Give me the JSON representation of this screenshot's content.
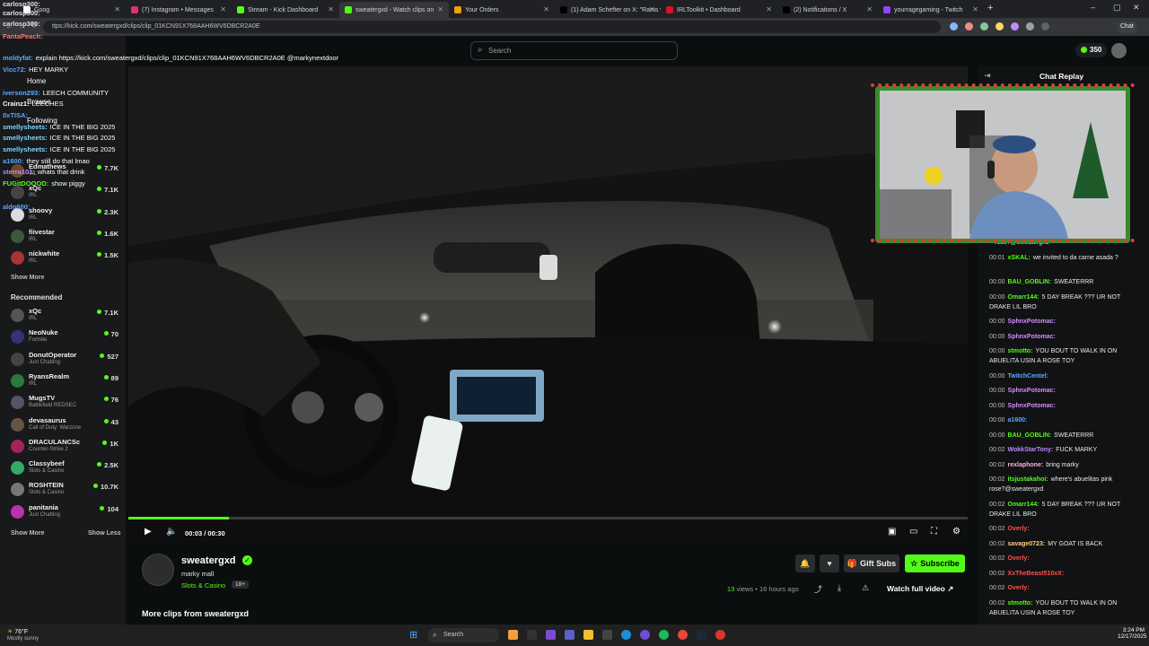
{
  "browser": {
    "tabs": [
      {
        "label": "Goog",
        "color": "#ffffff"
      },
      {
        "label": "(7) Instagram • Messages",
        "color": "#e1306c"
      },
      {
        "label": "Stream - Kick Dashboard",
        "color": "#53fc18"
      },
      {
        "label": "sweatergxd - Watch clips on",
        "color": "#53fc18"
      },
      {
        "label": "Your Orders",
        "color": "#f0a000"
      },
      {
        "label": "(1) Adam Schefter on X: \"Rams wi",
        "color": "#000000"
      },
      {
        "label": "IRLToolkit • Dashboard",
        "color": "#d12"
      },
      {
        "label": "(2) Notifications / X",
        "color": "#000000"
      },
      {
        "label": "yourragegaming - Twitch",
        "color": "#9146ff"
      }
    ],
    "url": "ttps://kick.com/sweatergxd/clips/clip_01KCN91X768AAH6WV6DBCR2A0E",
    "chat_button": "Chat"
  },
  "header": {
    "search_placeholder": "Search",
    "points": "350"
  },
  "overlay_chat": [
    {
      "user": "carlosp300:",
      "msg": "",
      "color": "#e0e0e0"
    },
    {
      "user": "carlosp300:",
      "msg": "",
      "color": "#e0e0e0"
    },
    {
      "user": "carlosp300:",
      "msg": "",
      "color": "#e0e0e0"
    },
    {
      "user": "FantaPeach:",
      "msg": "",
      "color": "#ff7b7b"
    },
    {
      "user": "moldyfat:",
      "msg": "explain https://kick.com/sweatergxd/clips/clip_01KCN91X768AAH6WV6DBCR2A0E @markynextdoor",
      "color": "#5aa9ff"
    },
    {
      "user": "Vicc72:",
      "msg": "HEY MARKY",
      "color": "#5aa9ff"
    },
    {
      "user": "",
      "msg": "Home",
      "color": "#ffffff"
    },
    {
      "user": "iverson293:",
      "msg": "LEECH COMMUNITY",
      "color": "#5aa9ff"
    },
    {
      "user": "Crainz1:",
      "msg": "LEECHES",
      "color": "#ffffff"
    },
    {
      "user": "0xTISA:",
      "msg": "",
      "color": "#5aa9ff"
    },
    {
      "user": "smellysheets:",
      "msg": "ICE IN THE BIG 2025",
      "color": "#7ad7ff"
    },
    {
      "user": "smellysheets:",
      "msg": "ICE IN THE BIG 2025",
      "color": "#7ad7ff"
    },
    {
      "user": "smellysheets:",
      "msg": "ICE IN THE BIG 2025",
      "color": "#7ad7ff"
    },
    {
      "user": "a1600:",
      "msg": "they still do that lmao",
      "color": "#5aa9ff"
    },
    {
      "user": "sterra101:",
      "msg": "whats that drink",
      "color": "#c08aff"
    },
    {
      "user": "FUGitDOOOD:",
      "msg": "show piggy",
      "color": "#53fc18"
    },
    {
      "user": "aldo600:",
      "msg": "",
      "color": "#5aa9ff"
    }
  ],
  "sidebar": {
    "following_label": "Following",
    "browse_label": "Browse",
    "following": [
      {
        "name": "Edmathews",
        "cat": "IRL",
        "viewers": "7.7K",
        "color": "#6b4a2b"
      },
      {
        "name": "xQc",
        "cat": "IRL",
        "viewers": "7.1K",
        "color": "#444"
      },
      {
        "name": "shoovy",
        "cat": "IRL",
        "viewers": "2.3K",
        "color": "#ddd"
      },
      {
        "name": "fiivestar",
        "cat": "IRL",
        "viewers": "1.6K",
        "color": "#3a5a3a"
      },
      {
        "name": "nickwhite",
        "cat": "IRL",
        "viewers": "1.5K",
        "color": "#a33"
      }
    ],
    "show_more": "Show More",
    "recommended_label": "Recommended",
    "recommended": [
      {
        "name": "xQc",
        "cat": "IRL",
        "viewers": "7.1K",
        "color": "#555"
      },
      {
        "name": "NeoNuke",
        "cat": "Fortnite",
        "viewers": "70",
        "color": "#337"
      },
      {
        "name": "DonutOperator",
        "cat": "Just Chatting",
        "viewers": "527",
        "color": "#444"
      },
      {
        "name": "RyansRealm",
        "cat": "IRL",
        "viewers": "89",
        "color": "#2a7a3a"
      },
      {
        "name": "MugsTV",
        "cat": "Battlefield REDSEC",
        "viewers": "76",
        "color": "#556"
      },
      {
        "name": "devasaurus",
        "cat": "Call of Duty: Warzone",
        "viewers": "43",
        "color": "#654"
      },
      {
        "name": "DRACULANCSc",
        "cat": "Counter-Strike 2",
        "viewers": "1K",
        "color": "#a1235a"
      },
      {
        "name": "Classybeef",
        "cat": "Slots & Casino",
        "viewers": "2.5K",
        "color": "#3a6"
      },
      {
        "name": "ROSHTEIN",
        "cat": "Slots & Casino",
        "viewers": "10.7K",
        "color": "#777"
      },
      {
        "name": "panitania",
        "cat": "Just Chatting",
        "viewers": "104",
        "color": "#b3a"
      }
    ],
    "show_more_2": "Show More",
    "show_less": "Show Less"
  },
  "player": {
    "time": "00:03 / 00:30",
    "progress": 0.12
  },
  "channel": {
    "name": "sweatergxd",
    "clip_title": "marky mall",
    "category": "Slots & Casino",
    "badge": "18+",
    "gift_subs": "Gift Subs",
    "subscribe": "Subscribe",
    "views": "13",
    "views_label": "views",
    "age": "• 16 hours ago",
    "watch_full": "Watch full video",
    "more_clips": "More clips from sweatergxd"
  },
  "chat_replay": {
    "title": "Chat Replay",
    "messages": [
      {
        "time": "",
        "user": "",
        "msg": "rose?@sweatergxd",
        "color": "#ffffff"
      },
      {
        "time": "00:01",
        "user": "xSKAL:",
        "msg": "we invited to da carne asada ?",
        "color": "#53fc18"
      },
      {
        "time": "00:00",
        "user": "BAU_GOBLIN:",
        "msg": "SWEATERRR",
        "color": "#53fc18"
      },
      {
        "time": "00:00",
        "user": "Omarr144:",
        "msg": "5 DAY BREAK ??? UR NOT DRAKE LIL BRO",
        "color": "#53fc18"
      },
      {
        "time": "00:00",
        "user": "SphnxPotomac:",
        "msg": "",
        "color": "#d58cff"
      },
      {
        "time": "00:00",
        "user": "SphnxPotomac:",
        "msg": "",
        "color": "#d58cff"
      },
      {
        "time": "00:00",
        "user": "stmotto:",
        "msg": "YOU BOUT TO WALK IN ON ABUELITA USIN A ROSE TOY",
        "color": "#53fc18"
      },
      {
        "time": "00:00",
        "user": "TwitchCentel:",
        "msg": "",
        "color": "#5aa9ff"
      },
      {
        "time": "00:00",
        "user": "SphnxPotomac:",
        "msg": "",
        "color": "#d58cff"
      },
      {
        "time": "00:00",
        "user": "SphnxPotomac:",
        "msg": "",
        "color": "#d58cff"
      },
      {
        "time": "00:00",
        "user": "a1600:",
        "msg": "",
        "color": "#5aa9ff"
      },
      {
        "time": "00:00",
        "user": "BAU_GOBLIN:",
        "msg": "SWEATERRR",
        "color": "#53fc18"
      },
      {
        "time": "00:02",
        "user": "WokkStarTony:",
        "msg": "FUCK MARKY",
        "color": "#c08aff"
      },
      {
        "time": "00:02",
        "user": "rexlaphone:",
        "msg": "bring marky",
        "color": "#ffb3d9"
      },
      {
        "time": "00:02",
        "user": "itsjustakahoi:",
        "msg": "where's abuelitas pink rose?@sweatergxd",
        "color": "#53fc18"
      },
      {
        "time": "00:02",
        "user": "Omarr144:",
        "msg": "5 DAY BREAK ??? UR NOT DRAKE LIL BRO",
        "color": "#53fc18"
      },
      {
        "time": "00:02",
        "user": "Overly:",
        "msg": "",
        "color": "#ff5050"
      },
      {
        "time": "00:02",
        "user": "savage0723:",
        "msg": "MY GOAT IS BACK",
        "color": "#ffd27a"
      },
      {
        "time": "00:02",
        "user": "Overly:",
        "msg": "",
        "color": "#ff5050"
      },
      {
        "time": "00:02",
        "user": "XxTheBeast510xX:",
        "msg": "",
        "color": "#ff5050"
      },
      {
        "time": "00:02",
        "user": "Overly:",
        "msg": "",
        "color": "#ff5050"
      },
      {
        "time": "00:02",
        "user": "stmotto:",
        "msg": "YOU BOUT TO WALK IN ON ABUELITA USIN A ROSE TOY",
        "color": "#53fc18"
      }
    ]
  },
  "taskbar": {
    "weather_temp": "76°F",
    "weather_desc": "Mostly sunny",
    "search": "Search",
    "time": "3:24 PM",
    "date": "12/17/2025"
  },
  "colors": {
    "accent": "#53fc18"
  }
}
